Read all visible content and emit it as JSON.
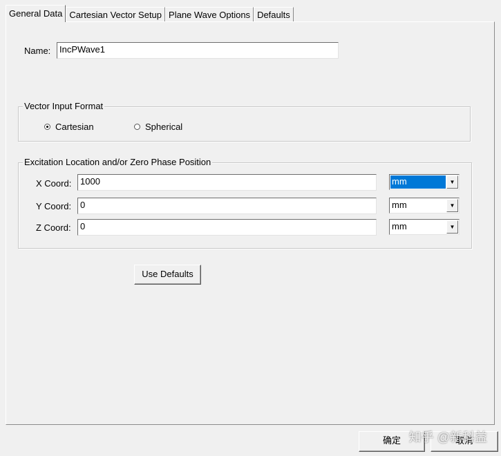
{
  "tabs": [
    {
      "label": "General Data"
    },
    {
      "label": "Cartesian Vector Setup"
    },
    {
      "label": "Plane Wave Options"
    },
    {
      "label": "Defaults"
    }
  ],
  "name": {
    "label": "Name:",
    "value": "IncPWave1"
  },
  "vector_format": {
    "title": "Vector Input Format",
    "options": [
      {
        "label": "Cartesian",
        "checked": true
      },
      {
        "label": "Spherical",
        "checked": false
      }
    ]
  },
  "excitation": {
    "title": "Excitation Location and/or Zero Phase Position",
    "coords": [
      {
        "label": "X Coord:",
        "value": "1000",
        "unit": "mm"
      },
      {
        "label": "Y Coord:",
        "value": "0",
        "unit": "mm"
      },
      {
        "label": "Z Coord:",
        "value": "0",
        "unit": "mm"
      }
    ]
  },
  "use_defaults_label": "Use Defaults",
  "footer": {
    "ok_label": "确定",
    "cancel_label": "取消"
  },
  "watermark": "知乎 @新科益",
  "colors": {
    "selection": "#0078d7",
    "background": "#f0f0f0"
  }
}
